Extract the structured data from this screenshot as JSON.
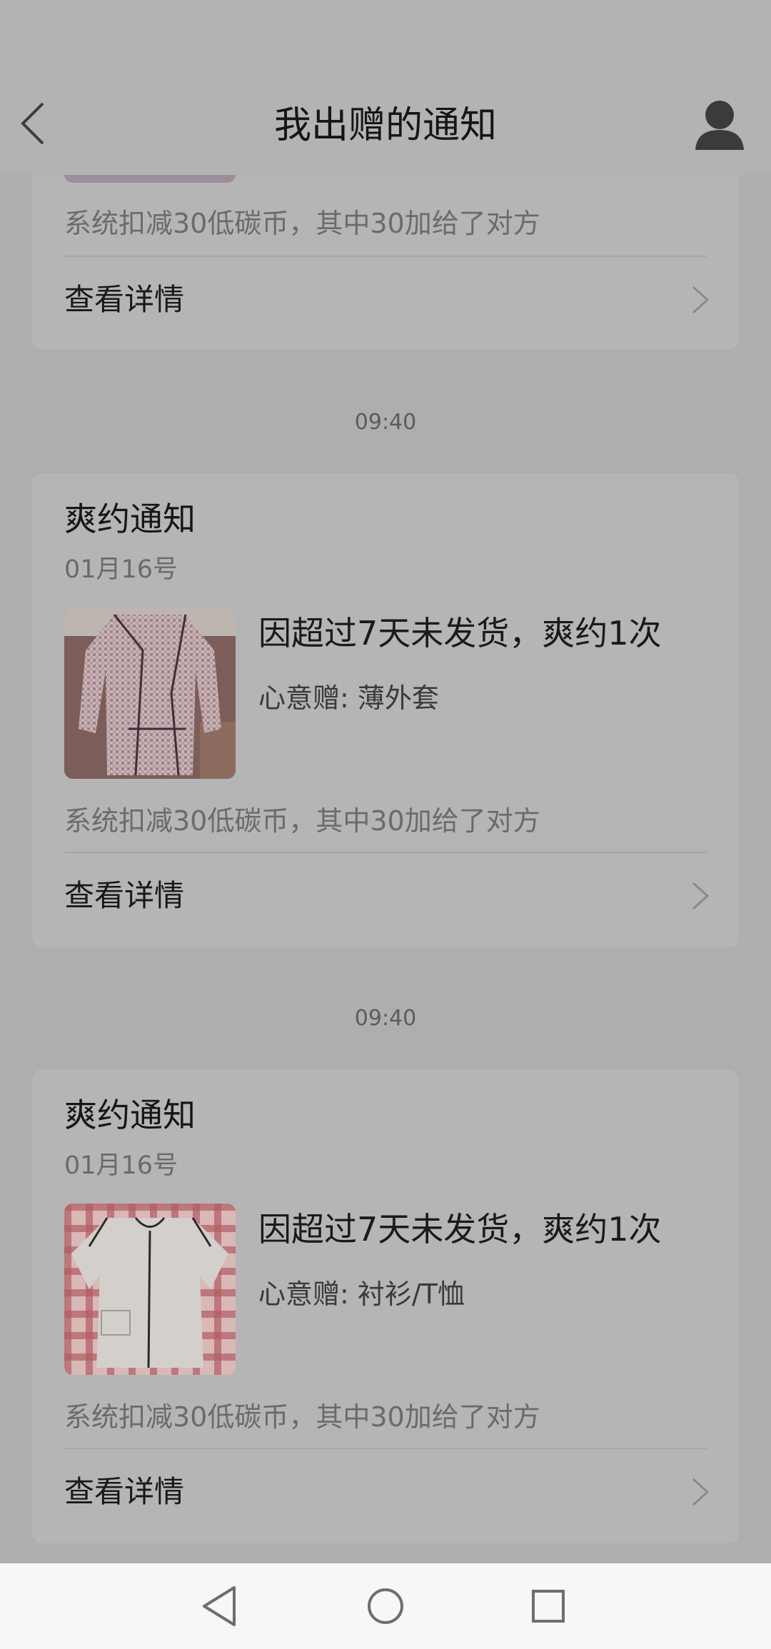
{
  "header": {
    "title": "我出赠的通知",
    "back_icon": "chevron-left-icon",
    "profile_icon": "user-icon"
  },
  "partial_card": {
    "note": "系统扣减30低碳币，其中30加给了对方",
    "details_label": "查看详情"
  },
  "notifications": [
    {
      "timestamp": "09:40",
      "title": "爽约通知",
      "date": "01月16号",
      "message": "因超过7天未发货，爽约1次",
      "item": "心意赠: 薄外套",
      "note": "系统扣减30低碳币，其中30加给了对方",
      "details_label": "查看详情"
    },
    {
      "timestamp": "09:40",
      "title": "爽约通知",
      "date": "01月16号",
      "message": "因超过7天未发货，爽约1次",
      "item": "心意赠: 衬衫/T恤",
      "note": "系统扣减30低碳币，其中30加给了对方",
      "details_label": "查看详情"
    }
  ],
  "navbar": {
    "back_icon": "triangle-back-icon",
    "home_icon": "circle-home-icon",
    "recents_icon": "square-recents-icon"
  }
}
